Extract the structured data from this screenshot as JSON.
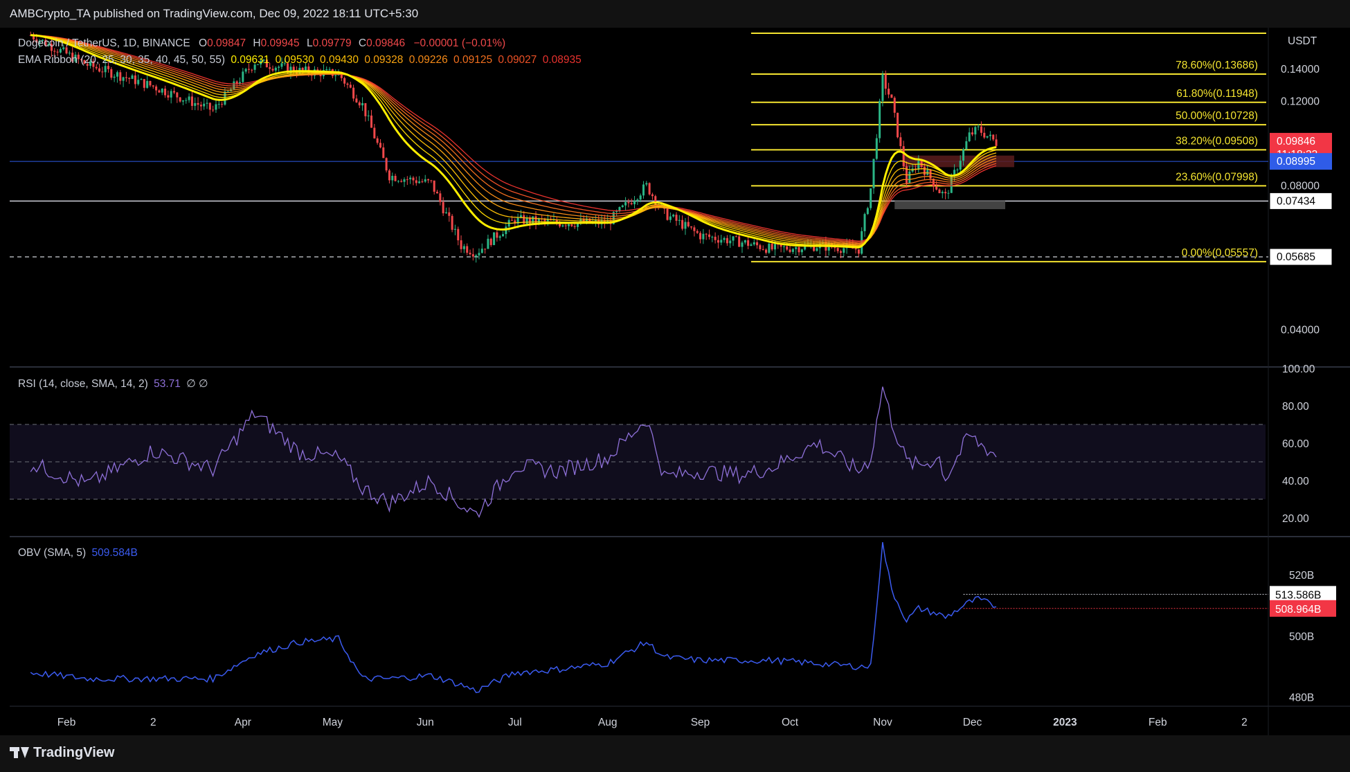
{
  "header": {
    "publisher": "AMBCrypto_TA published on TradingView.com, Dec 09, 2022 18:11 UTC+5:30"
  },
  "footer": {
    "brand": "TradingView"
  },
  "legend": {
    "symbol": "Dogecoin / TetherUS, 1D, BINANCE",
    "o_label": "O",
    "o": "0.09847",
    "h_label": "H",
    "h": "0.09945",
    "l_label": "L",
    "l": "0.09779",
    "c_label": "C",
    "c": "0.09846",
    "change": "−0.00001 (−0.01%)",
    "ema_label": "EMA Ribbon (20, 25, 30, 35, 40, 45, 50, 55)",
    "ema_values": [
      "0.09631",
      "0.09530",
      "0.09430",
      "0.09328",
      "0.09226",
      "0.09125",
      "0.09027",
      "0.08935"
    ],
    "rsi_label": "RSI (14, close, SMA, 14, 2)",
    "rsi_value": "53.71",
    "rsi_extra": "∅ ∅",
    "obv_label": "OBV (SMA, 5)",
    "obv_value": "509.584B"
  },
  "colors": {
    "background": "#000000",
    "fib": "#f5e530",
    "candle_up": "#2bb586",
    "candle_down": "#f0484a",
    "ema_fast": "#ffee00",
    "ema_slow": "#e8322e",
    "rsi_line": "#8e70d8",
    "obv_line": "#3b5bf0",
    "blue_hline": "#2f5ce8"
  },
  "chart_data": [
    {
      "type": "line",
      "title": "Dogecoin / TetherUS, 1D, BINANCE",
      "scale": "log",
      "ylabel": "USDT",
      "ylim": [
        0.0335,
        0.171
      ],
      "x_ticks": [
        "Feb",
        "2",
        "Apr",
        "May",
        "Jun",
        "Jul",
        "Aug",
        "Sep",
        "Oct",
        "Nov",
        "Dec",
        "2023",
        "Feb",
        "2"
      ],
      "x": [
        "2022-01-20",
        "2022-02-08",
        "2022-03-02",
        "2022-03-22",
        "2022-04-05",
        "2022-04-20",
        "2022-05-03",
        "2022-05-11",
        "2022-05-20",
        "2022-06-03",
        "2022-06-13",
        "2022-06-18",
        "2022-07-01",
        "2022-07-15",
        "2022-08-01",
        "2022-08-14",
        "2022-08-20",
        "2022-09-01",
        "2022-09-15",
        "2022-09-25",
        "2022-10-10",
        "2022-10-24",
        "2022-10-28",
        "2022-11-01",
        "2022-11-04",
        "2022-11-09",
        "2022-11-13",
        "2022-11-20",
        "2022-11-22",
        "2022-11-30",
        "2022-12-03",
        "2022-12-09"
      ],
      "close": [
        0.165,
        0.143,
        0.129,
        0.115,
        0.145,
        0.139,
        0.137,
        0.118,
        0.084,
        0.081,
        0.06,
        0.058,
        0.068,
        0.067,
        0.067,
        0.08,
        0.07,
        0.063,
        0.061,
        0.059,
        0.06,
        0.059,
        0.079,
        0.134,
        0.12,
        0.082,
        0.09,
        0.078,
        0.076,
        0.102,
        0.105,
        0.09846
      ],
      "y_ticks": [
        "0.14000",
        "0.12000",
        "0.08000",
        "0.04000"
      ],
      "fibonacci": [
        {
          "label": "78.60%(0.13686)",
          "value": 0.13686
        },
        {
          "label": "61.80%(0.11948)",
          "value": 0.11948
        },
        {
          "label": "50.00%(0.10728)",
          "value": 0.10728
        },
        {
          "label": "38.20%(0.09508)",
          "value": 0.09508
        },
        {
          "label": "23.60%(0.07998)",
          "value": 0.07998
        },
        {
          "label": "0.00%(0.05557)",
          "value": 0.05557
        }
      ],
      "price_tags": [
        {
          "text": "0.09846",
          "sub": "11:18:23",
          "value": 0.09846,
          "color": "#f23645"
        },
        {
          "text": "0.08995",
          "value": 0.08995,
          "color": "#2f5ce8"
        },
        {
          "text": "0.07434",
          "value": 0.07434,
          "color": "#ffffff"
        },
        {
          "text": "0.05685",
          "value": 0.05685,
          "color": "#ffffff"
        }
      ]
    },
    {
      "type": "line",
      "title": "RSI (14, close, SMA, 14, 2)",
      "ylim": [
        10,
        100
      ],
      "y_ticks": [
        "100.00",
        "80.00",
        "60.00",
        "40.00",
        "20.00"
      ],
      "bands": [
        70,
        50,
        30
      ],
      "x": [
        "2022-01-20",
        "2022-02-08",
        "2022-03-02",
        "2022-03-22",
        "2022-04-05",
        "2022-04-20",
        "2022-05-03",
        "2022-05-11",
        "2022-05-20",
        "2022-06-03",
        "2022-06-13",
        "2022-06-18",
        "2022-07-01",
        "2022-07-15",
        "2022-08-01",
        "2022-08-14",
        "2022-08-20",
        "2022-09-01",
        "2022-09-15",
        "2022-09-25",
        "2022-10-10",
        "2022-10-24",
        "2022-10-28",
        "2022-11-01",
        "2022-11-04",
        "2022-11-09",
        "2022-11-13",
        "2022-11-20",
        "2022-11-22",
        "2022-11-30",
        "2022-12-03",
        "2022-12-09"
      ],
      "values": [
        49,
        38,
        56,
        46,
        76,
        55,
        52,
        36,
        28,
        40,
        27,
        22,
        48,
        45,
        52,
        73,
        42,
        45,
        43,
        47,
        60,
        45,
        52,
        90,
        72,
        50,
        48,
        52,
        41,
        64,
        60,
        53.71
      ]
    },
    {
      "type": "line",
      "title": "OBV (SMA, 5)",
      "ylim": [
        477,
        532
      ],
      "y_ticks": [
        "520B",
        "500B",
        "480B"
      ],
      "x": [
        "2022-01-20",
        "2022-02-08",
        "2022-03-02",
        "2022-03-22",
        "2022-04-05",
        "2022-04-20",
        "2022-05-03",
        "2022-05-11",
        "2022-05-20",
        "2022-06-03",
        "2022-06-13",
        "2022-06-18",
        "2022-07-01",
        "2022-07-15",
        "2022-08-01",
        "2022-08-14",
        "2022-08-20",
        "2022-09-01",
        "2022-09-15",
        "2022-09-25",
        "2022-10-10",
        "2022-10-24",
        "2022-10-28",
        "2022-11-01",
        "2022-11-04",
        "2022-11-09",
        "2022-11-13",
        "2022-11-20",
        "2022-11-22",
        "2022-11-30",
        "2022-12-03",
        "2022-12-09"
      ],
      "values": [
        488,
        486,
        486,
        486,
        494,
        498,
        499,
        486,
        486,
        487,
        484,
        482,
        488,
        489,
        491,
        498,
        493,
        492,
        492,
        492,
        491,
        490,
        490,
        530,
        515,
        505,
        509,
        507,
        506,
        511,
        512,
        509.584
      ],
      "price_tags": [
        {
          "text": "513.586B",
          "value": 513.586,
          "color": "#ffffff"
        },
        {
          "text": "508.964B",
          "value": 508.964,
          "color": "#f23645"
        }
      ]
    }
  ]
}
